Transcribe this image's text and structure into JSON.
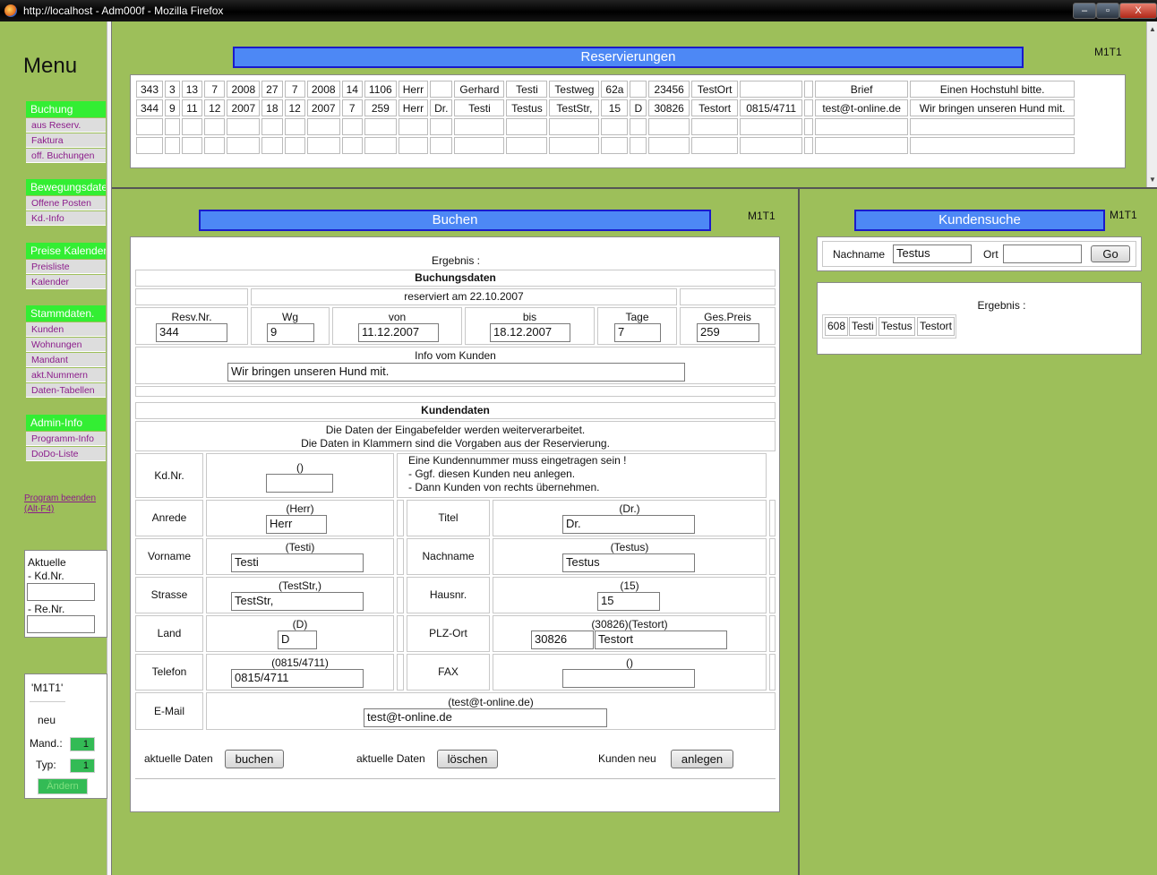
{
  "window": {
    "title": "http://localhost - Adm000f - Mozilla Firefox",
    "min": "–",
    "max": "▫",
    "close": "X"
  },
  "menu": {
    "title": "Menu",
    "sections": [
      {
        "head": "Buchung",
        "items": [
          "aus Reserv.",
          "Faktura",
          "off. Buchungen"
        ]
      },
      {
        "head": "Bewegungsdaten",
        "items": [
          "Offene Posten",
          "Kd.-Info"
        ]
      },
      {
        "head": "Preise Kalender",
        "items": [
          "Preisliste",
          "Kalender"
        ]
      },
      {
        "head": "Stammdaten.",
        "items": [
          "Kunden",
          "Wohnungen",
          "Mandant",
          "akt.Nummern",
          "Daten-Tabellen"
        ]
      },
      {
        "head": "Admin-Info",
        "items": [
          "Programm-Info",
          "DoDo-Liste"
        ]
      }
    ],
    "quit": "Program beenden (Alt-F4)",
    "aktuelle": {
      "title": "Aktuelle",
      "kdnr_label": "- Kd.Nr.",
      "renr_label": "- Re.Nr.",
      "kdnr": "",
      "renr": ""
    },
    "status": {
      "user": "'M1T1'",
      "mode": "neu",
      "mand_label": "Mand.:",
      "mand": "1",
      "typ_label": "Typ:",
      "typ": "1",
      "button": "Ändern"
    }
  },
  "reservations": {
    "title": "Reservierungen",
    "code": "M1T1",
    "rows": [
      [
        "343",
        "3",
        "13",
        "7",
        "2008",
        "27",
        "7",
        "2008",
        "14",
        "1106",
        "Herr",
        "",
        "Gerhard",
        "Testi",
        "Testweg",
        "62a",
        "",
        "23456",
        "TestOrt",
        "",
        "",
        "Brief",
        "Einen Hochstuhl bitte."
      ],
      [
        "344",
        "9",
        "11",
        "12",
        "2007",
        "18",
        "12",
        "2007",
        "7",
        "259",
        "Herr",
        "Dr.",
        "Testi",
        "Testus",
        "TestStr,",
        "15",
        "D",
        "30826",
        "Testort",
        "0815/4711",
        "",
        "test@t-online.de",
        "Wir bringen unseren Hund mit."
      ],
      [
        "",
        "",
        "",
        "",
        "",
        "",
        "",
        "",
        "",
        "",
        "",
        "",
        "",
        "",
        "",
        "",
        "",
        "",
        "",
        "",
        "",
        "",
        ""
      ],
      [
        "",
        "",
        "",
        "",
        "",
        "",
        "",
        "",
        "",
        "",
        "",
        "",
        "",
        "",
        "",
        "",
        "",
        "",
        "",
        "",
        "",
        "",
        ""
      ]
    ]
  },
  "buchen": {
    "title": "Buchen",
    "code": "M1T1",
    "ergebnis": "Ergebnis :",
    "buchungsdaten": "Buchungsdaten",
    "reserviert": "reserviert am 22.10.2007",
    "resv_label": "Resv.Nr.",
    "resv": "344",
    "wg_label": "Wg",
    "wg": "9",
    "von_label": "von",
    "von": "11.12.2007",
    "bis_label": "bis",
    "bis": "18.12.2007",
    "tage_label": "Tage",
    "tage": "7",
    "preis_label": "Ges.Preis",
    "preis": "259",
    "info_label": "Info vom Kunden",
    "info": "Wir bringen unseren Hund mit.",
    "kundendaten": "Kundendaten",
    "note1": "Die Daten der Eingabefelder werden weiterverarbeitet.",
    "note2": "Die Daten in Klammern sind die Vorgaben aus der Reservierung.",
    "kdnr_label": "Kd.Nr.",
    "kdnr_hint": "()",
    "kdnr": "",
    "kdnr_msg1": "Eine Kundennummer muss eingetragen sein !",
    "kdnr_msg2": "- Ggf. diesen Kunden neu anlegen.",
    "kdnr_msg3": "- Dann Kunden von rechts übernehmen.",
    "anrede_label": "Anrede",
    "anrede_hint": "(Herr)",
    "anrede": "Herr",
    "titel_label": "Titel",
    "titel_hint": "(Dr.)",
    "titel": "Dr.",
    "vorname_label": "Vorname",
    "vorname_hint": "(Testi)",
    "vorname": "Testi",
    "nachname_label": "Nachname",
    "nachname_hint": "(Testus)",
    "nachname": "Testus",
    "strasse_label": "Strasse",
    "strasse_hint": "(TestStr,)",
    "strasse": "TestStr,",
    "hausnr_label": "Hausnr.",
    "hausnr_hint": "(15)",
    "hausnr": "15",
    "land_label": "Land",
    "land_hint": "(D)",
    "land": "D",
    "plz_label": "PLZ-Ort",
    "plz_hint": "(30826)(Testort)",
    "plz": "30826",
    "ort": "Testort",
    "telefon_label": "Telefon",
    "telefon_hint": "(0815/4711)",
    "telefon": "0815/4711",
    "fax_label": "FAX",
    "fax_hint": "()",
    "fax": "",
    "email_label": "E-Mail",
    "email_hint": "(test@t-online.de)",
    "email": "test@t-online.de",
    "akt1": "aktuelle Daten",
    "buchen_btn": "buchen",
    "akt2": "aktuelle Daten",
    "loeschen_btn": "löschen",
    "neu_label": "Kunden neu",
    "anlegen_btn": "anlegen"
  },
  "kundensuche": {
    "title": "Kundensuche",
    "code": "M1T1",
    "nachname_label": "Nachname",
    "nachname": "Testus",
    "ort_label": "Ort",
    "ort": "",
    "go": "Go",
    "ergebnis": "Ergebnis :",
    "result": [
      "608",
      "Testi",
      "Testus",
      "Testort"
    ]
  }
}
